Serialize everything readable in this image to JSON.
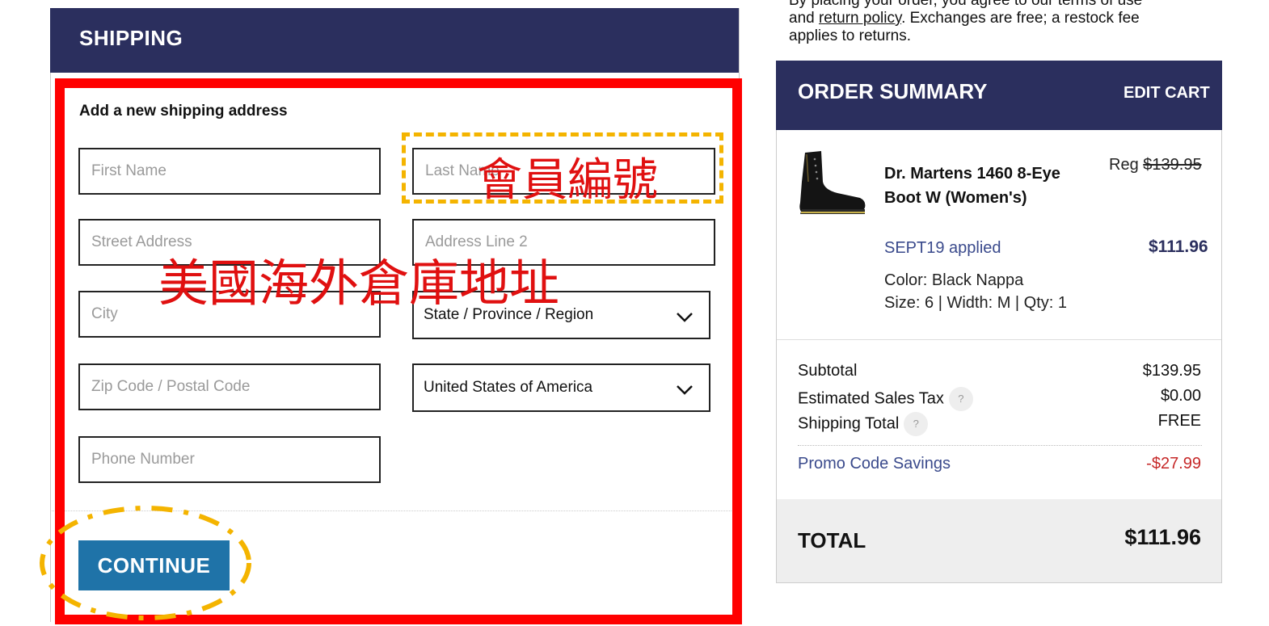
{
  "policy": {
    "line1": "By placing your order, you agree to our terms of use",
    "line2_a": "and ",
    "line2_link": "return policy",
    "line2_b": ". Exchanges are free; a restock fee",
    "line3": "applies to returns."
  },
  "shipping": {
    "title": "SHIPPING",
    "subtitle": "Add a new shipping address",
    "fields": {
      "first_name": "First Name",
      "last_name": "Last Name",
      "street": "Street Address",
      "address2": "Address Line 2",
      "city": "City",
      "state": "State / Province / Region",
      "zip": "Zip Code / Postal Code",
      "country": "United States of America",
      "phone": "Phone Number"
    },
    "continue_label": "CONTINUE"
  },
  "annotations": {
    "member_number": "會員編號",
    "warehouse_address": "美國海外倉庫地址"
  },
  "summary": {
    "title": "ORDER SUMMARY",
    "edit_cart": "EDIT CART",
    "product": {
      "name": "Dr. Martens 1460 8-Eye Boot W (Women's)",
      "reg_label": "Reg",
      "reg_price": "$139.95",
      "promo_applied": "SEPT19 applied",
      "sale_price": "$111.96",
      "color": "Color: Black Nappa",
      "size": "Size: 6 | Width: M | Qty: 1"
    },
    "lines": [
      {
        "label": "Subtotal",
        "value": "$139.95"
      },
      {
        "label": "Estimated Sales Tax",
        "value": "$0.00"
      },
      {
        "label": "Shipping Total",
        "value": "FREE"
      }
    ],
    "help_icon": "?",
    "promo_label": "Promo Code Savings",
    "promo_value": "-$27.99",
    "total_label": "TOTAL",
    "total_value": "$111.96"
  },
  "colors": {
    "header_navy": "#2b2f5e",
    "button_blue": "#1f73a8",
    "annotation_red": "#ff0000",
    "annotation_orange": "#f4b400",
    "discount_red": "#c62828"
  }
}
